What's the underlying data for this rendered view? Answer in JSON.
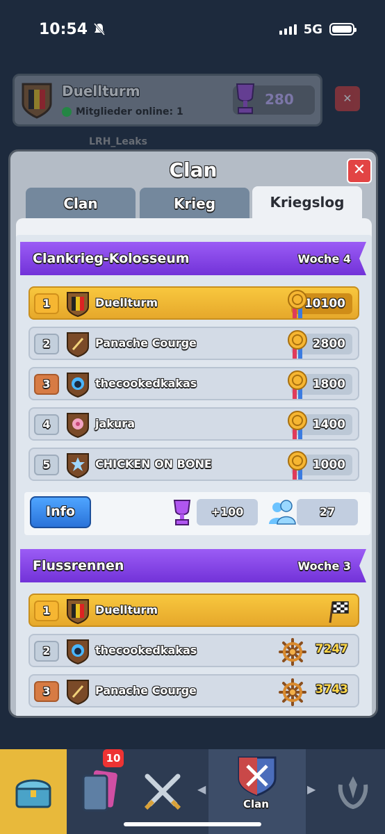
{
  "status_bar": {
    "time": "10:54",
    "network": "5G"
  },
  "background": {
    "clan_name": "Duellturm",
    "online_text": "Mitglieder online: 1",
    "trophies": "280",
    "leader": "LRH_Leaks"
  },
  "modal": {
    "title": "Clan",
    "tabs": [
      {
        "label": "Clan"
      },
      {
        "label": "Krieg"
      },
      {
        "label": "Kriegslog"
      }
    ]
  },
  "colosseum": {
    "title": "Clankrieg-Kolosseum",
    "week": "Woche 4",
    "rows": [
      {
        "rank": "1",
        "name": "Duellturm",
        "score": "10100"
      },
      {
        "rank": "2",
        "name": "Panache Courge",
        "score": "2800"
      },
      {
        "rank": "3",
        "name": "thecookedkakas",
        "score": "1800"
      },
      {
        "rank": "4",
        "name": "jakura",
        "score": "1400"
      },
      {
        "rank": "5",
        "name": "CHICKEN ON BONE",
        "score": "1000"
      }
    ],
    "info_label": "Info",
    "trophy_change": "+100",
    "participants": "27"
  },
  "river_race": {
    "title": "Flussrennen",
    "week": "Woche 3",
    "rows": [
      {
        "rank": "1",
        "name": "Duellturm",
        "fame": ""
      },
      {
        "rank": "2",
        "name": "thecookedkakas",
        "fame": "7247"
      },
      {
        "rank": "3",
        "name": "Panache Courge",
        "fame": "3743"
      }
    ]
  },
  "bottom_nav": {
    "cards_badge": "10",
    "clan_label": "Clan"
  },
  "colors": {
    "accent_purple": "#7232d8",
    "gold": "#f6b632",
    "bronze": "#d77b44"
  }
}
